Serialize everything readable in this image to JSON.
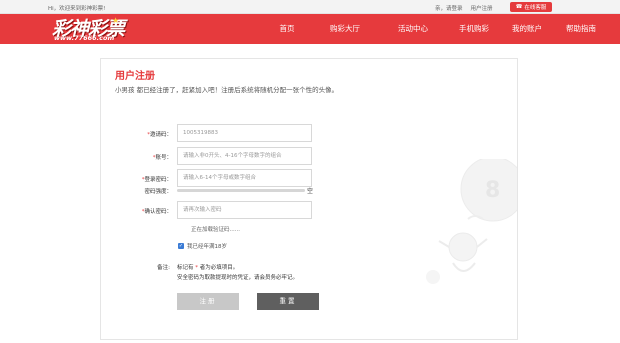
{
  "topbar": {
    "welcome": "Hi，欢迎来到彩神彩票!",
    "greeting": "亲，请登录",
    "user_center": "用户注册",
    "online_service": "在线客服"
  },
  "header": {
    "logo_text": "彩神彩票",
    "logo_url": "www.77666.com",
    "nav": [
      "首页",
      "购彩大厅",
      "活动中心",
      "手机购彩",
      "我的账户",
      "帮助指南"
    ]
  },
  "form": {
    "title": "用户注册",
    "intro": "小男孩 都已经注册了，赶紧加入吧！注册后系统将随机分配一张个性的头像。",
    "invite": {
      "label": "邀请码：",
      "value": "1005319883"
    },
    "account": {
      "label": "账号：",
      "placeholder": "请输入非0开头、4-16个字母数字的组合"
    },
    "password": {
      "label": "登录密码：",
      "placeholder": "请输入6-14个字母或数字组合"
    },
    "strength": {
      "label": "密码强度：",
      "value": "空"
    },
    "confirm": {
      "label": "确认密码：",
      "placeholder": "请再次输入密码"
    },
    "captcha_loading": "正在加载验证码......",
    "agree": "我已经年满18岁",
    "notes_label": "备注:",
    "note1_prefix": "标记有",
    "note1_star": "*",
    "note1_suffix": "者为必填项目。",
    "note2": "安全密码为取款提现时的凭证，请会员务必牢记。",
    "register_btn": "注册",
    "reset_btn": "重置"
  },
  "colors": {
    "brand_red": "#e63a3d",
    "reset_btn": "#5f5f5f",
    "register_btn": "#c8c8c8"
  }
}
